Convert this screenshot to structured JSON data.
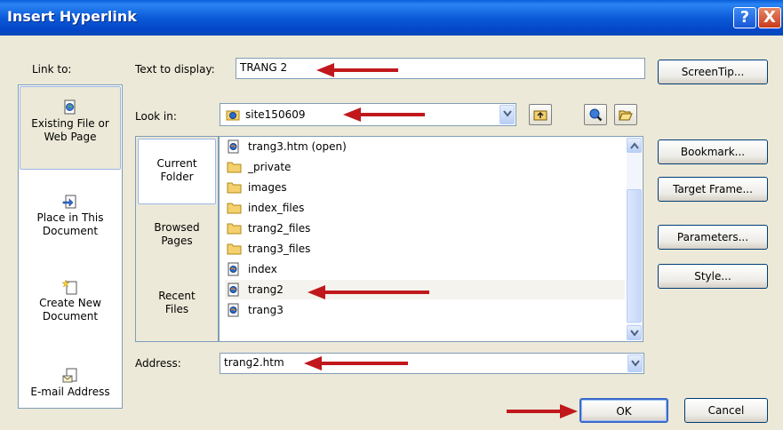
{
  "window": {
    "title": "Insert Hyperlink",
    "help_label": "?",
    "close_label": "X"
  },
  "link_to": {
    "label": "Link to:",
    "items": [
      {
        "line1": "Existing File or",
        "line2": "Web Page"
      },
      {
        "line1": "Place in This",
        "line2": "Document"
      },
      {
        "line1": "Create New",
        "line2": "Document"
      },
      {
        "line1": "E-mail Address",
        "line2": ""
      }
    ]
  },
  "text_to_display": {
    "label": "Text to display:",
    "value": "TRANG 2"
  },
  "look_in": {
    "label": "Look in:",
    "value": "site150609"
  },
  "places": [
    {
      "line1": "Current",
      "line2": "Folder"
    },
    {
      "line1": "Browsed",
      "line2": "Pages"
    },
    {
      "line1": "Recent",
      "line2": "Files"
    }
  ],
  "files": [
    {
      "name": "trang3.htm (open)",
      "type": "page"
    },
    {
      "name": "_private",
      "type": "folder"
    },
    {
      "name": "images",
      "type": "folder"
    },
    {
      "name": "index_files",
      "type": "folder"
    },
    {
      "name": "trang2_files",
      "type": "folder"
    },
    {
      "name": "trang3_files",
      "type": "folder"
    },
    {
      "name": "index",
      "type": "page"
    },
    {
      "name": "trang2",
      "type": "page"
    },
    {
      "name": "trang3",
      "type": "page"
    }
  ],
  "address": {
    "label": "Address:",
    "value": "trang2.htm"
  },
  "buttons": {
    "screentip": "ScreenTip...",
    "bookmark": "Bookmark...",
    "target_frame": "Target Frame...",
    "parameters": "Parameters...",
    "style": "Style...",
    "ok": "OK",
    "cancel": "Cancel"
  },
  "colors": {
    "titlebar": "#0A5FD8",
    "dialog_bg": "#ECE9D8",
    "annotation_arrow": "#C0181C",
    "folder_icon": "#F4D06F",
    "page_icon": "#2D6BC7"
  }
}
